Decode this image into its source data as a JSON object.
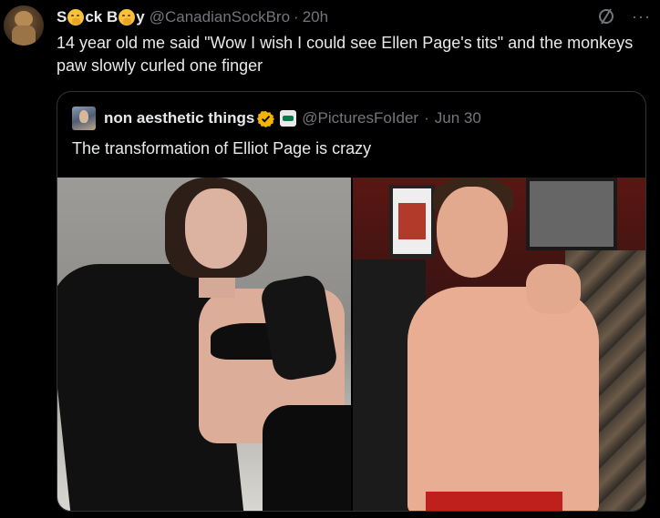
{
  "tweet": {
    "display_name_parts": [
      "S",
      "ck B",
      "y"
    ],
    "emoji_name": "smiling-face-with-hand-over-mouth",
    "handle": "@CanadianSockBro",
    "separator": "·",
    "time": "20h",
    "text": "14 year old me said \"Wow I wish I could see Ellen Page's tits\" and the monkeys paw slowly curled one finger",
    "icons": {
      "grok": "grok-icon",
      "more": "more-icon"
    },
    "more_glyph": "···"
  },
  "quote": {
    "display_name": "non aesthetic things",
    "verified_color": "#f4b400",
    "handle": "@PicturesFoIder",
    "separator": "·",
    "date": "Jun 30",
    "text": "The transformation of Elliot Page is crazy",
    "media": [
      {
        "name": "photo-left"
      },
      {
        "name": "photo-right"
      }
    ]
  },
  "colors": {
    "background": "#000000",
    "text": "#e7e9ea",
    "muted": "#71767b",
    "border": "#2f3336"
  }
}
